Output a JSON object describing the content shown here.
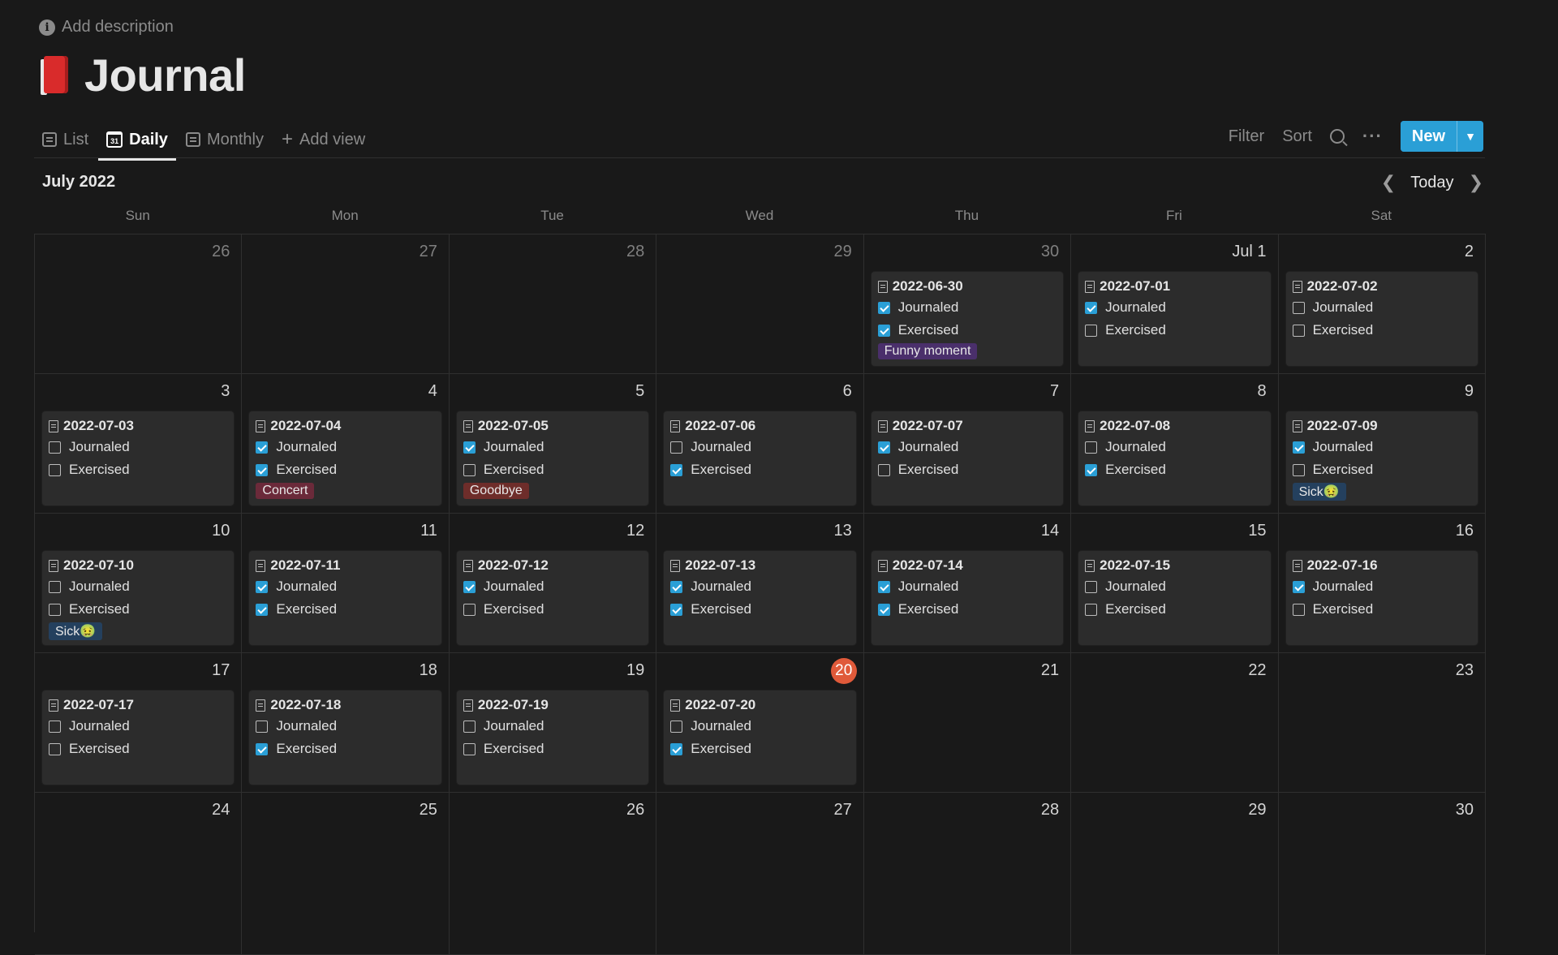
{
  "header": {
    "add_description": "Add description",
    "title": "Journal",
    "icon": "red-book-icon"
  },
  "tabs": [
    {
      "label": "List",
      "icon": "list-icon",
      "active": false
    },
    {
      "label": "Daily",
      "icon": "calendar-icon",
      "active": true
    },
    {
      "label": "Monthly",
      "icon": "list-icon",
      "active": false
    },
    {
      "label": "Add view",
      "icon": "plus-icon",
      "active": false
    }
  ],
  "toolbar": {
    "filter": "Filter",
    "sort": "Sort",
    "more": "···",
    "new": "New"
  },
  "calendar": {
    "month_label": "July 2022",
    "today_label": "Today",
    "weekdays": [
      "Sun",
      "Mon",
      "Tue",
      "Wed",
      "Thu",
      "Fri",
      "Sat"
    ],
    "cells": [
      {
        "day": "26",
        "muted": true
      },
      {
        "day": "27",
        "muted": true
      },
      {
        "day": "28",
        "muted": true
      },
      {
        "day": "29",
        "muted": true
      },
      {
        "day": "30",
        "muted": true,
        "entry": {
          "title": "2022-06-30",
          "journaled": true,
          "exercised": true,
          "tag": "Funny moment",
          "tag_color": "#4a2f6b"
        }
      },
      {
        "day": "Jul 1",
        "entry": {
          "title": "2022-07-01",
          "journaled": true,
          "exercised": false
        }
      },
      {
        "day": "2",
        "entry": {
          "title": "2022-07-02",
          "journaled": false,
          "exercised": false
        }
      },
      {
        "day": "3",
        "entry": {
          "title": "2022-07-03",
          "journaled": false,
          "exercised": false
        }
      },
      {
        "day": "4",
        "entry": {
          "title": "2022-07-04",
          "journaled": true,
          "exercised": true,
          "tag": "Concert",
          "tag_color": "#6b2a3a"
        }
      },
      {
        "day": "5",
        "entry": {
          "title": "2022-07-05",
          "journaled": true,
          "exercised": false,
          "tag": "Goodbye",
          "tag_color": "#6e2d2a"
        }
      },
      {
        "day": "6",
        "entry": {
          "title": "2022-07-06",
          "journaled": false,
          "exercised": true
        }
      },
      {
        "day": "7",
        "entry": {
          "title": "2022-07-07",
          "journaled": true,
          "exercised": false
        }
      },
      {
        "day": "8",
        "entry": {
          "title": "2022-07-08",
          "journaled": false,
          "exercised": true
        }
      },
      {
        "day": "9",
        "entry": {
          "title": "2022-07-09",
          "journaled": true,
          "exercised": false,
          "tag": "Sick🤢",
          "tag_color": "#24405e"
        }
      },
      {
        "day": "10",
        "entry": {
          "title": "2022-07-10",
          "journaled": false,
          "exercised": false,
          "tag": "Sick🤢",
          "tag_color": "#24405e"
        }
      },
      {
        "day": "11",
        "entry": {
          "title": "2022-07-11",
          "journaled": true,
          "exercised": true
        }
      },
      {
        "day": "12",
        "entry": {
          "title": "2022-07-12",
          "journaled": true,
          "exercised": false
        }
      },
      {
        "day": "13",
        "entry": {
          "title": "2022-07-13",
          "journaled": true,
          "exercised": true
        }
      },
      {
        "day": "14",
        "entry": {
          "title": "2022-07-14",
          "journaled": true,
          "exercised": true
        }
      },
      {
        "day": "15",
        "entry": {
          "title": "2022-07-15",
          "journaled": false,
          "exercised": false
        }
      },
      {
        "day": "16",
        "entry": {
          "title": "2022-07-16",
          "journaled": true,
          "exercised": false
        }
      },
      {
        "day": "17",
        "entry": {
          "title": "2022-07-17",
          "journaled": false,
          "exercised": false
        }
      },
      {
        "day": "18",
        "entry": {
          "title": "2022-07-18",
          "journaled": false,
          "exercised": true
        }
      },
      {
        "day": "19",
        "entry": {
          "title": "2022-07-19",
          "journaled": false,
          "exercised": false
        }
      },
      {
        "day": "20",
        "today": true,
        "entry": {
          "title": "2022-07-20",
          "journaled": false,
          "exercised": true
        }
      },
      {
        "day": "21"
      },
      {
        "day": "22"
      },
      {
        "day": "23"
      },
      {
        "day": "24"
      },
      {
        "day": "25"
      },
      {
        "day": "26"
      },
      {
        "day": "27"
      },
      {
        "day": "28"
      },
      {
        "day": "29"
      },
      {
        "day": "30"
      }
    ],
    "property_labels": {
      "journaled": "Journaled",
      "exercised": "Exercised"
    }
  },
  "colors": {
    "accent": "#2a9fd6",
    "today": "#e05a3a",
    "background": "#191919",
    "card": "#2c2c2c"
  }
}
